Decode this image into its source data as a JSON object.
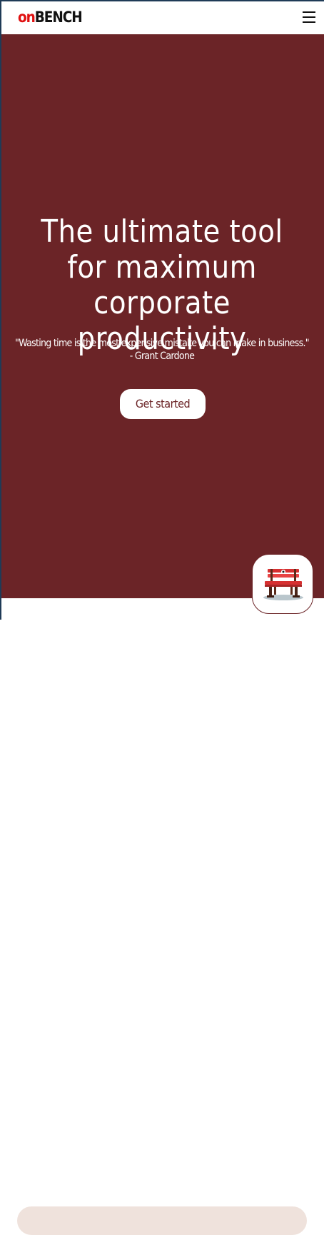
{
  "brand": {
    "logo_prefix": "on",
    "logo_main": "BENCH",
    "prefix_color": "#e01010",
    "main_color": "#111111"
  },
  "nav": {
    "menu_icon": "hamburger-menu-icon"
  },
  "hero": {
    "background": "#6b2427",
    "title": "The ultimate tool for maximum corporate productivity",
    "quote": "\"Wasting time is the most expensive mistake you can make in business.\"",
    "quote_author": "- Grant Cardone",
    "cta_label": "Get started"
  },
  "floating_button": {
    "icon": "bench-icon"
  }
}
